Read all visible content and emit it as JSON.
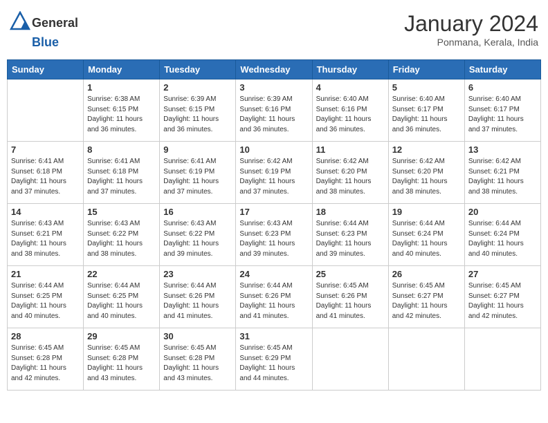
{
  "header": {
    "logo_general": "General",
    "logo_blue": "Blue",
    "month_title": "January 2024",
    "location": "Ponmana, Kerala, India"
  },
  "days_of_week": [
    "Sunday",
    "Monday",
    "Tuesday",
    "Wednesday",
    "Thursday",
    "Friday",
    "Saturday"
  ],
  "weeks": [
    [
      {
        "day": "",
        "info": ""
      },
      {
        "day": "1",
        "info": "Sunrise: 6:38 AM\nSunset: 6:15 PM\nDaylight: 11 hours\nand 36 minutes."
      },
      {
        "day": "2",
        "info": "Sunrise: 6:39 AM\nSunset: 6:15 PM\nDaylight: 11 hours\nand 36 minutes."
      },
      {
        "day": "3",
        "info": "Sunrise: 6:39 AM\nSunset: 6:16 PM\nDaylight: 11 hours\nand 36 minutes."
      },
      {
        "day": "4",
        "info": "Sunrise: 6:40 AM\nSunset: 6:16 PM\nDaylight: 11 hours\nand 36 minutes."
      },
      {
        "day": "5",
        "info": "Sunrise: 6:40 AM\nSunset: 6:17 PM\nDaylight: 11 hours\nand 36 minutes."
      },
      {
        "day": "6",
        "info": "Sunrise: 6:40 AM\nSunset: 6:17 PM\nDaylight: 11 hours\nand 37 minutes."
      }
    ],
    [
      {
        "day": "7",
        "info": "Sunrise: 6:41 AM\nSunset: 6:18 PM\nDaylight: 11 hours\nand 37 minutes."
      },
      {
        "day": "8",
        "info": "Sunrise: 6:41 AM\nSunset: 6:18 PM\nDaylight: 11 hours\nand 37 minutes."
      },
      {
        "day": "9",
        "info": "Sunrise: 6:41 AM\nSunset: 6:19 PM\nDaylight: 11 hours\nand 37 minutes."
      },
      {
        "day": "10",
        "info": "Sunrise: 6:42 AM\nSunset: 6:19 PM\nDaylight: 11 hours\nand 37 minutes."
      },
      {
        "day": "11",
        "info": "Sunrise: 6:42 AM\nSunset: 6:20 PM\nDaylight: 11 hours\nand 38 minutes."
      },
      {
        "day": "12",
        "info": "Sunrise: 6:42 AM\nSunset: 6:20 PM\nDaylight: 11 hours\nand 38 minutes."
      },
      {
        "day": "13",
        "info": "Sunrise: 6:42 AM\nSunset: 6:21 PM\nDaylight: 11 hours\nand 38 minutes."
      }
    ],
    [
      {
        "day": "14",
        "info": "Sunrise: 6:43 AM\nSunset: 6:21 PM\nDaylight: 11 hours\nand 38 minutes."
      },
      {
        "day": "15",
        "info": "Sunrise: 6:43 AM\nSunset: 6:22 PM\nDaylight: 11 hours\nand 38 minutes."
      },
      {
        "day": "16",
        "info": "Sunrise: 6:43 AM\nSunset: 6:22 PM\nDaylight: 11 hours\nand 39 minutes."
      },
      {
        "day": "17",
        "info": "Sunrise: 6:43 AM\nSunset: 6:23 PM\nDaylight: 11 hours\nand 39 minutes."
      },
      {
        "day": "18",
        "info": "Sunrise: 6:44 AM\nSunset: 6:23 PM\nDaylight: 11 hours\nand 39 minutes."
      },
      {
        "day": "19",
        "info": "Sunrise: 6:44 AM\nSunset: 6:24 PM\nDaylight: 11 hours\nand 40 minutes."
      },
      {
        "day": "20",
        "info": "Sunrise: 6:44 AM\nSunset: 6:24 PM\nDaylight: 11 hours\nand 40 minutes."
      }
    ],
    [
      {
        "day": "21",
        "info": "Sunrise: 6:44 AM\nSunset: 6:25 PM\nDaylight: 11 hours\nand 40 minutes."
      },
      {
        "day": "22",
        "info": "Sunrise: 6:44 AM\nSunset: 6:25 PM\nDaylight: 11 hours\nand 40 minutes."
      },
      {
        "day": "23",
        "info": "Sunrise: 6:44 AM\nSunset: 6:26 PM\nDaylight: 11 hours\nand 41 minutes."
      },
      {
        "day": "24",
        "info": "Sunrise: 6:44 AM\nSunset: 6:26 PM\nDaylight: 11 hours\nand 41 minutes."
      },
      {
        "day": "25",
        "info": "Sunrise: 6:45 AM\nSunset: 6:26 PM\nDaylight: 11 hours\nand 41 minutes."
      },
      {
        "day": "26",
        "info": "Sunrise: 6:45 AM\nSunset: 6:27 PM\nDaylight: 11 hours\nand 42 minutes."
      },
      {
        "day": "27",
        "info": "Sunrise: 6:45 AM\nSunset: 6:27 PM\nDaylight: 11 hours\nand 42 minutes."
      }
    ],
    [
      {
        "day": "28",
        "info": "Sunrise: 6:45 AM\nSunset: 6:28 PM\nDaylight: 11 hours\nand 42 minutes."
      },
      {
        "day": "29",
        "info": "Sunrise: 6:45 AM\nSunset: 6:28 PM\nDaylight: 11 hours\nand 43 minutes."
      },
      {
        "day": "30",
        "info": "Sunrise: 6:45 AM\nSunset: 6:28 PM\nDaylight: 11 hours\nand 43 minutes."
      },
      {
        "day": "31",
        "info": "Sunrise: 6:45 AM\nSunset: 6:29 PM\nDaylight: 11 hours\nand 44 minutes."
      },
      {
        "day": "",
        "info": ""
      },
      {
        "day": "",
        "info": ""
      },
      {
        "day": "",
        "info": ""
      }
    ]
  ]
}
